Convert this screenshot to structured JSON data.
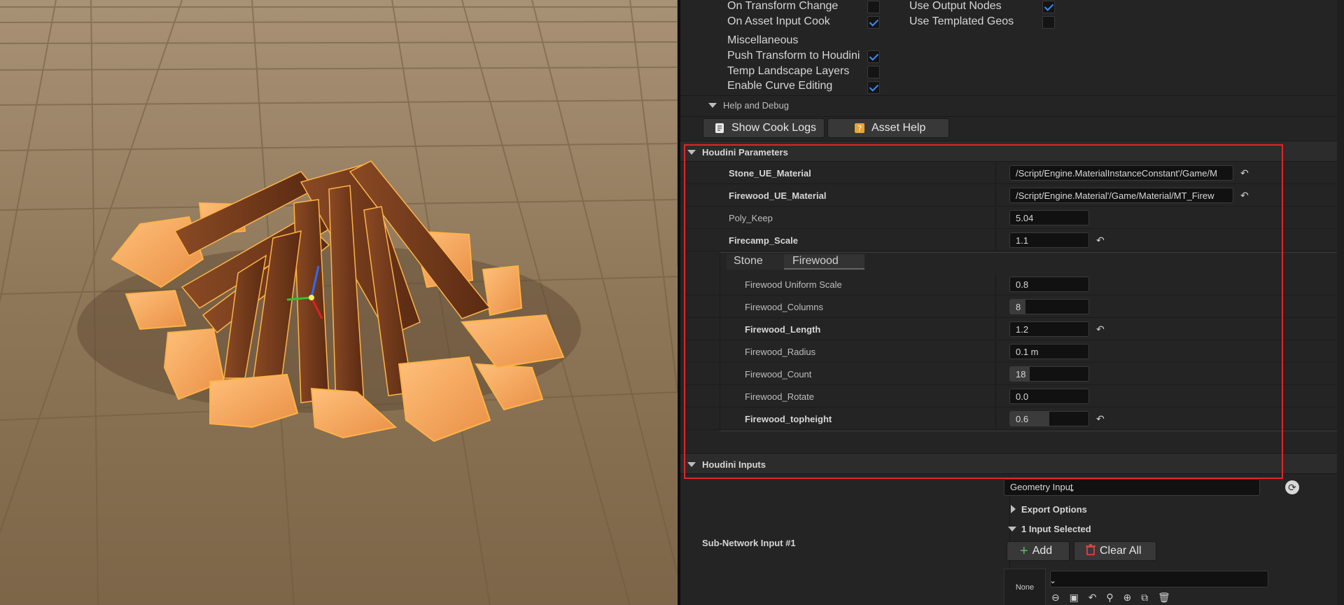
{
  "settings": {
    "on_transform_change": {
      "label": "On Transform Change",
      "checked": false
    },
    "on_asset_input_cook": {
      "label": "On Asset Input Cook",
      "checked": true
    },
    "use_output_nodes": {
      "label": "Use Output Nodes",
      "checked": true
    },
    "use_templated_geos": {
      "label": "Use Templated Geos",
      "checked": false
    },
    "misc_label": "Miscellaneous",
    "push_transform": {
      "label": "Push Transform to Houdini",
      "checked": true
    },
    "temp_landscape": {
      "label": "Temp Landscape Layers",
      "checked": false
    },
    "enable_curve": {
      "label": "Enable Curve Editing",
      "checked": true
    }
  },
  "help_debug": {
    "title": "Help and Debug",
    "show_cook_logs": "Show Cook Logs",
    "asset_help": "Asset Help"
  },
  "houdini_parameters": {
    "title": "Houdini Parameters",
    "stone_material": {
      "label": "Stone_UE_Material",
      "value": "/Script/Engine.MaterialInstanceConstant'/Game/M"
    },
    "firewood_material": {
      "label": "Firewood_UE_Material",
      "value": "/Script/Engine.Material'/Game/Material/MT_Firew"
    },
    "poly_keep": {
      "label": "Poly_Keep",
      "value": "5.04"
    },
    "firecamp_scale": {
      "label": "Firecamp_Scale",
      "value": "1.1"
    },
    "tabs": [
      "Stone",
      "Firewood"
    ],
    "firewood": [
      {
        "label": "Firewood Uniform Scale",
        "value": "0.8",
        "bold": false,
        "fill": 0.0
      },
      {
        "label": "Firewood_Columns",
        "value": "8",
        "bold": false,
        "fill": 0.2
      },
      {
        "label": "Firewood_Length",
        "value": "1.2",
        "bold": true,
        "fill": 0.0
      },
      {
        "label": "Firewood_Radius",
        "value": "0.1 m",
        "bold": false,
        "fill": 0.0
      },
      {
        "label": "Firewood_Count",
        "value": "18",
        "bold": false,
        "fill": 0.25
      },
      {
        "label": "Firewood_Rotate",
        "value": "0.0",
        "bold": false,
        "fill": 0.0
      },
      {
        "label": "Firewood_topheight",
        "value": "0.6",
        "bold": true,
        "fill": 0.5
      }
    ]
  },
  "houdini_inputs": {
    "title": "Houdini Inputs",
    "input_type": "Geometry Input",
    "export_options": "Export Options",
    "input_selected": "1 Input Selected",
    "subnetwork_label": "Sub-Network Input #1",
    "add_label": "Add",
    "clear_all_label": "Clear All",
    "none_label": "None"
  },
  "colors": {
    "accent_check": "#3d8cff",
    "highlight_box": "#e0262b",
    "wood": "#7a3e1e",
    "stone": "#f4a85a"
  }
}
